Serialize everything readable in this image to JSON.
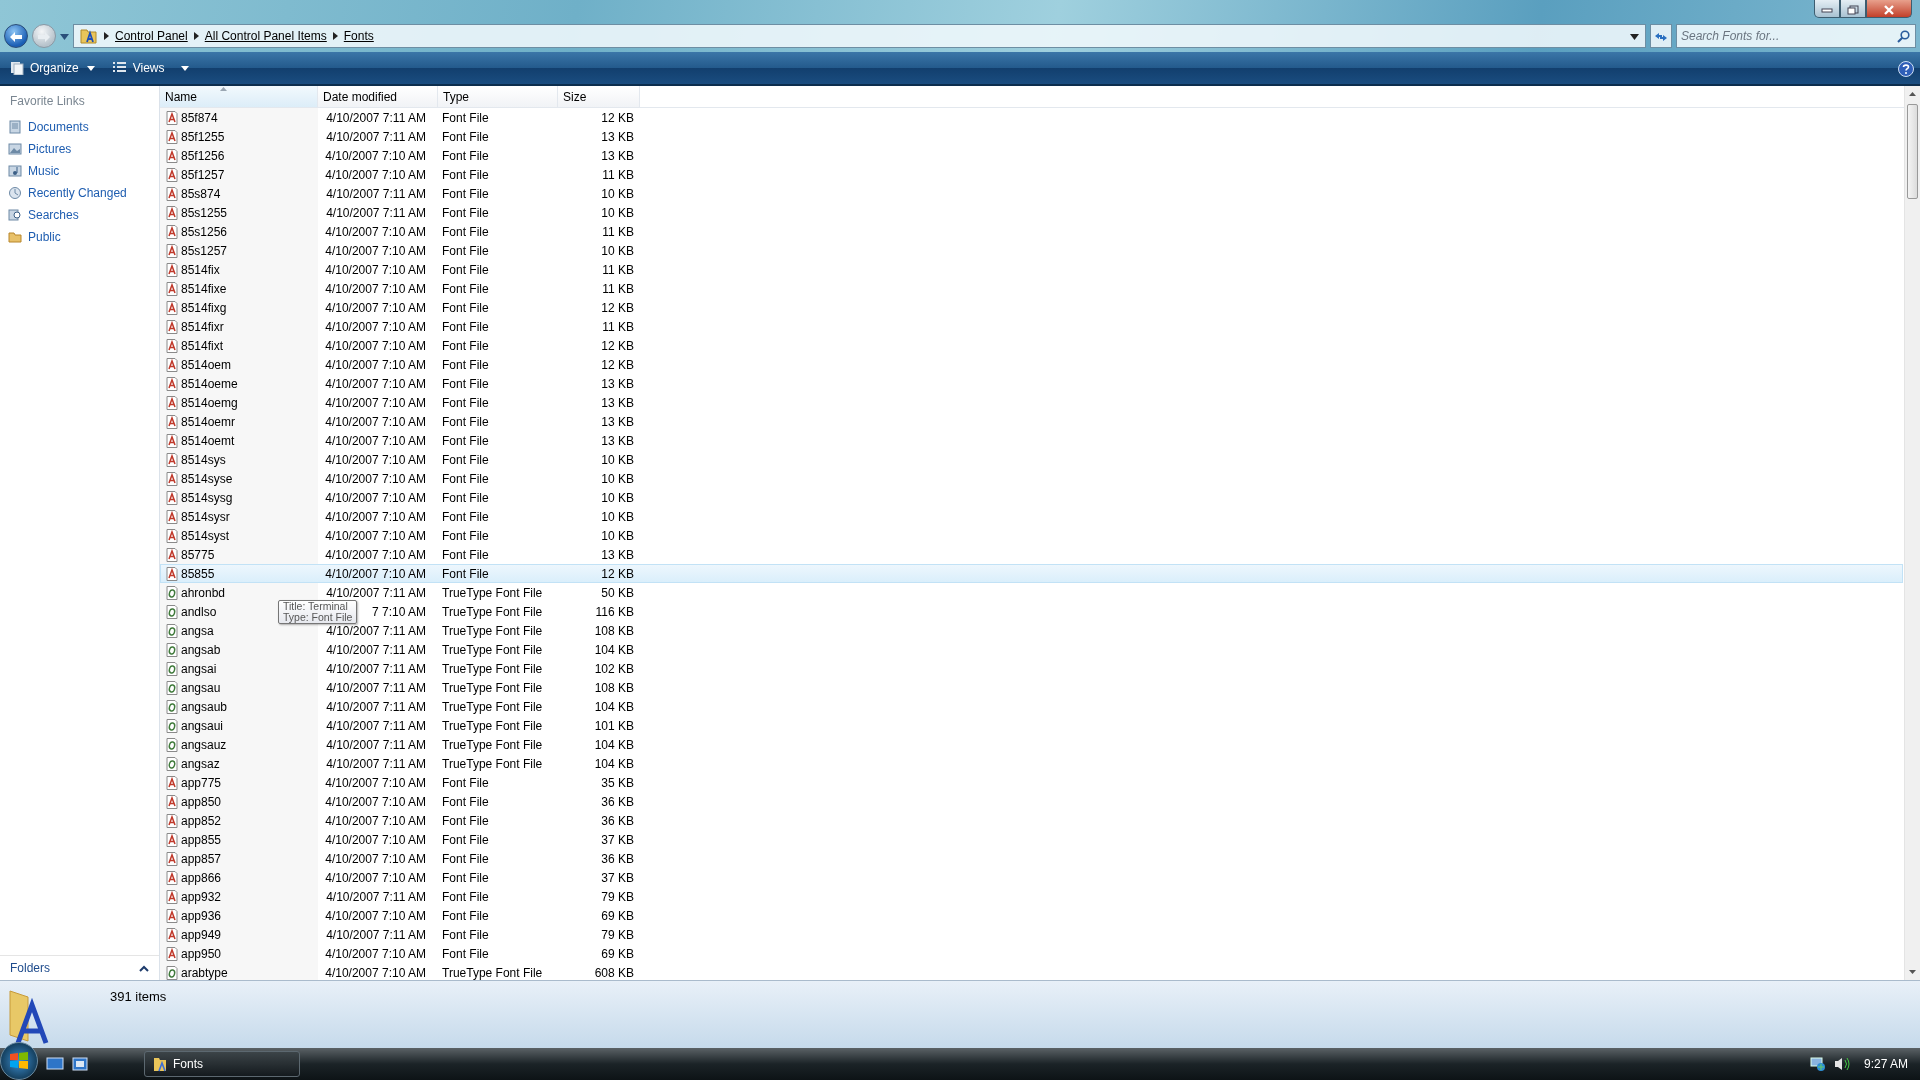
{
  "address": {
    "crumbs": [
      "Control Panel",
      "All Control Panel Items",
      "Fonts"
    ]
  },
  "search": {
    "placeholder": "Search Fonts for..."
  },
  "toolbar": {
    "buttons": [
      "Organize",
      "Views"
    ]
  },
  "sidebar": {
    "heading": "Favorite Links",
    "items": [
      {
        "label": "Documents"
      },
      {
        "label": "Pictures"
      },
      {
        "label": "Music"
      },
      {
        "label": "Recently Changed"
      },
      {
        "label": "Searches"
      },
      {
        "label": "Public"
      }
    ],
    "folders": "Folders"
  },
  "table": {
    "columns": [
      {
        "label": "Name",
        "sorted": true
      },
      {
        "label": "Date modified",
        "sorted": false
      },
      {
        "label": "Type",
        "sorted": false
      },
      {
        "label": "Size",
        "sorted": false
      }
    ],
    "rows": [
      {
        "name": "85f874",
        "date": "4/10/2007 7:11 AM",
        "type": "Font File",
        "size": "12 KB",
        "kind": "bitmap",
        "hovered": false
      },
      {
        "name": "85f1255",
        "date": "4/10/2007 7:11 AM",
        "type": "Font File",
        "size": "13 KB",
        "kind": "bitmap",
        "hovered": false
      },
      {
        "name": "85f1256",
        "date": "4/10/2007 7:10 AM",
        "type": "Font File",
        "size": "13 KB",
        "kind": "bitmap",
        "hovered": false
      },
      {
        "name": "85f1257",
        "date": "4/10/2007 7:10 AM",
        "type": "Font File",
        "size": "11 KB",
        "kind": "bitmap",
        "hovered": false
      },
      {
        "name": "85s874",
        "date": "4/10/2007 7:11 AM",
        "type": "Font File",
        "size": "10 KB",
        "kind": "bitmap",
        "hovered": false
      },
      {
        "name": "85s1255",
        "date": "4/10/2007 7:11 AM",
        "type": "Font File",
        "size": "10 KB",
        "kind": "bitmap",
        "hovered": false
      },
      {
        "name": "85s1256",
        "date": "4/10/2007 7:10 AM",
        "type": "Font File",
        "size": "11 KB",
        "kind": "bitmap",
        "hovered": false
      },
      {
        "name": "85s1257",
        "date": "4/10/2007 7:10 AM",
        "type": "Font File",
        "size": "10 KB",
        "kind": "bitmap",
        "hovered": false
      },
      {
        "name": "8514fix",
        "date": "4/10/2007 7:10 AM",
        "type": "Font File",
        "size": "11 KB",
        "kind": "bitmap",
        "hovered": false
      },
      {
        "name": "8514fixe",
        "date": "4/10/2007 7:10 AM",
        "type": "Font File",
        "size": "11 KB",
        "kind": "bitmap",
        "hovered": false
      },
      {
        "name": "8514fixg",
        "date": "4/10/2007 7:10 AM",
        "type": "Font File",
        "size": "12 KB",
        "kind": "bitmap",
        "hovered": false
      },
      {
        "name": "8514fixr",
        "date": "4/10/2007 7:10 AM",
        "type": "Font File",
        "size": "11 KB",
        "kind": "bitmap",
        "hovered": false
      },
      {
        "name": "8514fixt",
        "date": "4/10/2007 7:10 AM",
        "type": "Font File",
        "size": "12 KB",
        "kind": "bitmap",
        "hovered": false
      },
      {
        "name": "8514oem",
        "date": "4/10/2007 7:10 AM",
        "type": "Font File",
        "size": "12 KB",
        "kind": "bitmap",
        "hovered": false
      },
      {
        "name": "8514oeme",
        "date": "4/10/2007 7:10 AM",
        "type": "Font File",
        "size": "13 KB",
        "kind": "bitmap",
        "hovered": false
      },
      {
        "name": "8514oemg",
        "date": "4/10/2007 7:10 AM",
        "type": "Font File",
        "size": "13 KB",
        "kind": "bitmap",
        "hovered": false
      },
      {
        "name": "8514oemr",
        "date": "4/10/2007 7:10 AM",
        "type": "Font File",
        "size": "13 KB",
        "kind": "bitmap",
        "hovered": false
      },
      {
        "name": "8514oemt",
        "date": "4/10/2007 7:10 AM",
        "type": "Font File",
        "size": "13 KB",
        "kind": "bitmap",
        "hovered": false
      },
      {
        "name": "8514sys",
        "date": "4/10/2007 7:10 AM",
        "type": "Font File",
        "size": "10 KB",
        "kind": "bitmap",
        "hovered": false
      },
      {
        "name": "8514syse",
        "date": "4/10/2007 7:10 AM",
        "type": "Font File",
        "size": "10 KB",
        "kind": "bitmap",
        "hovered": false
      },
      {
        "name": "8514sysg",
        "date": "4/10/2007 7:10 AM",
        "type": "Font File",
        "size": "10 KB",
        "kind": "bitmap",
        "hovered": false
      },
      {
        "name": "8514sysr",
        "date": "4/10/2007 7:10 AM",
        "type": "Font File",
        "size": "10 KB",
        "kind": "bitmap",
        "hovered": false
      },
      {
        "name": "8514syst",
        "date": "4/10/2007 7:10 AM",
        "type": "Font File",
        "size": "10 KB",
        "kind": "bitmap",
        "hovered": false
      },
      {
        "name": "85775",
        "date": "4/10/2007 7:10 AM",
        "type": "Font File",
        "size": "13 KB",
        "kind": "bitmap",
        "hovered": false
      },
      {
        "name": "85855",
        "date": "4/10/2007 7:10 AM",
        "type": "Font File",
        "size": "12 KB",
        "kind": "bitmap",
        "hovered": true
      },
      {
        "name": "ahronbd",
        "date": "4/10/2007 7:11 AM",
        "type": "TrueType Font File",
        "size": "50 KB",
        "kind": "truetype",
        "hovered": false
      },
      {
        "name": "andlso",
        "date": "7 7:10 AM",
        "type": "TrueType Font File",
        "size": "116 KB",
        "kind": "truetype",
        "hovered": false,
        "tooltip": {
          "lines": [
            "Title: Terminal",
            "Type: Font File"
          ]
        }
      },
      {
        "name": "angsa",
        "date": "4/10/2007 7:11 AM",
        "type": "TrueType Font File",
        "size": "108 KB",
        "kind": "truetype",
        "hovered": false
      },
      {
        "name": "angsab",
        "date": "4/10/2007 7:11 AM",
        "type": "TrueType Font File",
        "size": "104 KB",
        "kind": "truetype",
        "hovered": false
      },
      {
        "name": "angsai",
        "date": "4/10/2007 7:11 AM",
        "type": "TrueType Font File",
        "size": "102 KB",
        "kind": "truetype",
        "hovered": false
      },
      {
        "name": "angsau",
        "date": "4/10/2007 7:11 AM",
        "type": "TrueType Font File",
        "size": "108 KB",
        "kind": "truetype",
        "hovered": false
      },
      {
        "name": "angsaub",
        "date": "4/10/2007 7:11 AM",
        "type": "TrueType Font File",
        "size": "104 KB",
        "kind": "truetype",
        "hovered": false
      },
      {
        "name": "angsaui",
        "date": "4/10/2007 7:11 AM",
        "type": "TrueType Font File",
        "size": "101 KB",
        "kind": "truetype",
        "hovered": false
      },
      {
        "name": "angsauz",
        "date": "4/10/2007 7:11 AM",
        "type": "TrueType Font File",
        "size": "104 KB",
        "kind": "truetype",
        "hovered": false
      },
      {
        "name": "angsaz",
        "date": "4/10/2007 7:11 AM",
        "type": "TrueType Font File",
        "size": "104 KB",
        "kind": "truetype",
        "hovered": false
      },
      {
        "name": "app775",
        "date": "4/10/2007 7:10 AM",
        "type": "Font File",
        "size": "35 KB",
        "kind": "bitmap",
        "hovered": false
      },
      {
        "name": "app850",
        "date": "4/10/2007 7:10 AM",
        "type": "Font File",
        "size": "36 KB",
        "kind": "bitmap",
        "hovered": false
      },
      {
        "name": "app852",
        "date": "4/10/2007 7:10 AM",
        "type": "Font File",
        "size": "36 KB",
        "kind": "bitmap",
        "hovered": false
      },
      {
        "name": "app855",
        "date": "4/10/2007 7:10 AM",
        "type": "Font File",
        "size": "37 KB",
        "kind": "bitmap",
        "hovered": false
      },
      {
        "name": "app857",
        "date": "4/10/2007 7:10 AM",
        "type": "Font File",
        "size": "36 KB",
        "kind": "bitmap",
        "hovered": false
      },
      {
        "name": "app866",
        "date": "4/10/2007 7:10 AM",
        "type": "Font File",
        "size": "37 KB",
        "kind": "bitmap",
        "hovered": false
      },
      {
        "name": "app932",
        "date": "4/10/2007 7:11 AM",
        "type": "Font File",
        "size": "79 KB",
        "kind": "bitmap",
        "hovered": false
      },
      {
        "name": "app936",
        "date": "4/10/2007 7:10 AM",
        "type": "Font File",
        "size": "69 KB",
        "kind": "bitmap",
        "hovered": false
      },
      {
        "name": "app949",
        "date": "4/10/2007 7:11 AM",
        "type": "Font File",
        "size": "79 KB",
        "kind": "bitmap",
        "hovered": false
      },
      {
        "name": "app950",
        "date": "4/10/2007 7:10 AM",
        "type": "Font File",
        "size": "69 KB",
        "kind": "bitmap",
        "hovered": false
      },
      {
        "name": "arabtype",
        "date": "4/10/2007 7:10 AM",
        "type": "TrueType Font File",
        "size": "608 KB",
        "kind": "truetype",
        "hovered": false
      }
    ]
  },
  "details": {
    "count": "391 items"
  },
  "taskbar": {
    "tasks": [
      {
        "label": "Fonts"
      }
    ],
    "clock": "9:27 AM"
  }
}
